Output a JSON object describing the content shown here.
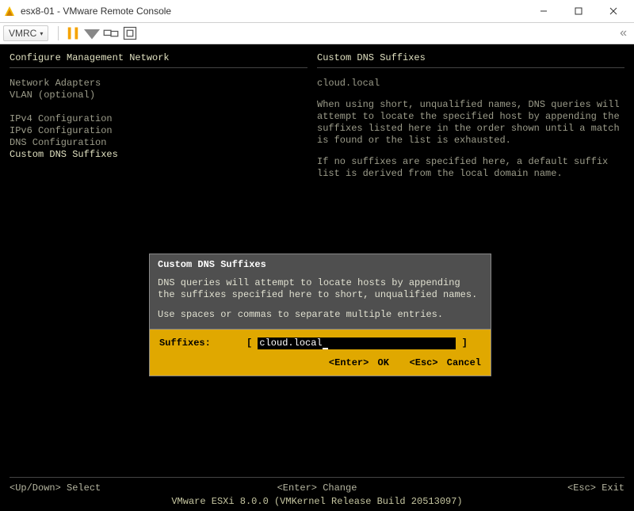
{
  "window": {
    "title": "esx8-01 - VMware Remote Console"
  },
  "toolbar": {
    "menu_label": "VMRC"
  },
  "console": {
    "left": {
      "header": "Configure Management Network",
      "menu": [
        "Network Adapters",
        "VLAN (optional)",
        "",
        "IPv4 Configuration",
        "IPv6 Configuration",
        "DNS Configuration",
        "Custom DNS Suffixes"
      ],
      "selected_index": 6
    },
    "right": {
      "header": "Custom DNS Suffixes",
      "value": "cloud.local",
      "para1": "When using short, unqualified names, DNS queries will attempt to locate the specified host by appending the suffixes listed here in the order shown until a match is found or the list is exhausted.",
      "para2": "If no suffixes are specified here, a default suffix list is derived from the local domain name."
    },
    "status": {
      "left": "<Up/Down> Select",
      "mid": "<Enter> Change",
      "right": "<Esc> Exit"
    },
    "version": "VMware ESXi 8.0.0 (VMKernel Release Build 20513097)"
  },
  "dialog": {
    "title": "Custom DNS Suffixes",
    "para1": "DNS queries will attempt to locate hosts by appending the suffixes specified here to short, unqualified names.",
    "para2": "Use spaces or commas to separate multiple entries.",
    "input_label": "Suffixes:",
    "input_value": "cloud.local",
    "ok_key": "<Enter>",
    "ok_label": "OK",
    "cancel_key": "<Esc>",
    "cancel_label": "Cancel"
  }
}
